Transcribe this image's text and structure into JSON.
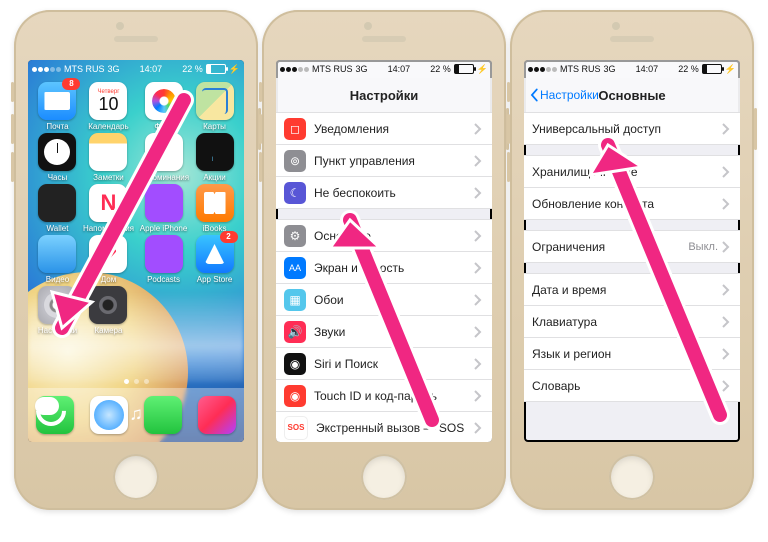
{
  "status": {
    "carrier": "MTS RUS",
    "net": "3G",
    "time": "14:07",
    "battery_pct": "22 %",
    "charging": true
  },
  "phone1": {
    "calendar": {
      "weekday": "Четверг",
      "day": "10"
    },
    "badges": {
      "mail": "8",
      "appstore": "2"
    },
    "apps": {
      "mail": "Почта",
      "calendar": "Календарь",
      "photos": "Фото",
      "maps": "Карты",
      "clock": "Часы",
      "notes": "Заметки",
      "reminders": "Напоминания",
      "stocks": "Акции",
      "wallet": "Wallet",
      "news": "Напоминания",
      "apple_iphone": "Apple iPhone",
      "ibooks": "iBooks",
      "video": "Видео",
      "health": "Дом",
      "podcasts": "Podcasts",
      "appstore": "App Store",
      "settings": "Настройки",
      "camera": "Камера"
    }
  },
  "phone2": {
    "title": "Настройки",
    "rows": {
      "notifications": "Уведомления",
      "control_center": "Пункт управления",
      "dnd": "Не беспокоить",
      "general": "Основные",
      "display": "Экран и яркость",
      "wallpaper": "Обои",
      "sounds": "Звуки",
      "siri": "Siri и Поиск",
      "touchid": "Touch ID и код-пароль",
      "sos": "Экстренный вызов — SOS"
    }
  },
  "phone3": {
    "back": "Настройки",
    "title": "Основные",
    "rows": {
      "accessibility": "Универсальный доступ",
      "storage": "Хранилище iPhone",
      "bg_refresh": "Обновление контента",
      "restrictions": "Ограничения",
      "restrictions_val": "Выкл.",
      "datetime": "Дата и время",
      "keyboard": "Клавиатура",
      "lang": "Язык и регион",
      "dict": "Словарь"
    }
  }
}
